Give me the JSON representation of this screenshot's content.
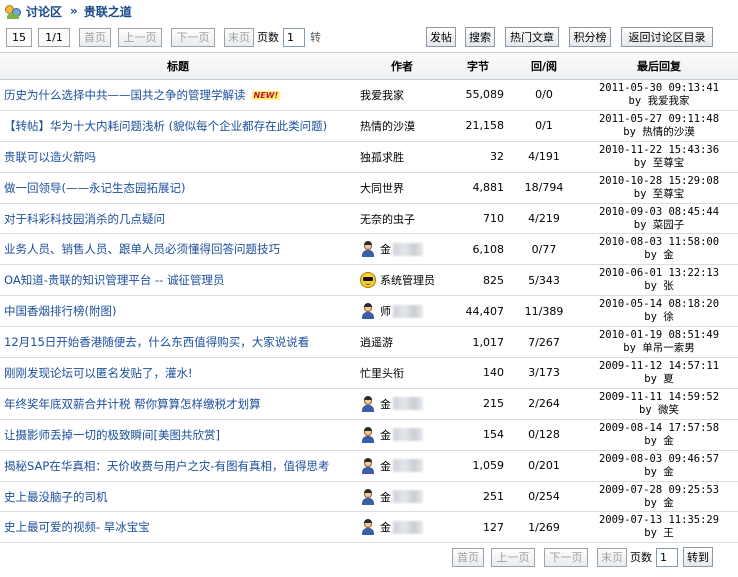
{
  "breadcrumb": {
    "root": "讨论区",
    "separator": "»",
    "current": "贵联之道"
  },
  "pager": {
    "per_page": "15",
    "page_of": "1/1",
    "first": "首页",
    "prev": "上一页",
    "next": "下一页",
    "last": "末页",
    "page_label": "页数",
    "page_value": "1",
    "jump_partial": "转",
    "jump": "转到"
  },
  "actions": {
    "post": "发帖",
    "search": "搜索",
    "hot": "热门文章",
    "ranking": "积分榜",
    "back": "返回讨论区目录"
  },
  "columns": {
    "title": "标题",
    "author": "作者",
    "bytes": "字节",
    "reply_view": "回/阅",
    "last_reply": "最后回复"
  },
  "new_badge": "NEW!",
  "rows": [
    {
      "title": "历史为什么选择中共——国共之争的管理学解读",
      "new": true,
      "author": "我爱我家",
      "avatar": "none",
      "bytes": "55,089",
      "rv": "0/0",
      "time": "2011-05-30 09:13:41",
      "by": "by 我爱我家"
    },
    {
      "title": "【转帖】华为十大内耗问题浅析 (貌似每个企业都存在此类问题)",
      "new": false,
      "author": "热情的沙漠",
      "avatar": "none",
      "bytes": "21,158",
      "rv": "0/1",
      "time": "2011-05-27 09:11:48",
      "by": "by 热情的沙漠"
    },
    {
      "title": "贵联可以造火箭吗",
      "new": false,
      "author": "独孤求胜",
      "avatar": "none",
      "bytes": "32",
      "rv": "4/191",
      "time": "2010-11-22 15:43:36",
      "by": "by 至尊宝"
    },
    {
      "title": "做一回领导(——永记生态园拓展记)",
      "new": false,
      "author": "大同世界",
      "avatar": "none",
      "bytes": "4,881",
      "rv": "18/794",
      "time": "2010-10-28 15:29:08",
      "by": "by 至尊宝"
    },
    {
      "title": "对于科彩科技园消杀的几点疑问",
      "new": false,
      "author": "无奈的虫子",
      "avatar": "none",
      "bytes": "710",
      "rv": "4/219",
      "time": "2010-09-03 08:45:44",
      "by": "by 菜园子"
    },
    {
      "title": "业务人员、销售人员、跟单人员必须懂得回答问题技巧",
      "new": false,
      "author": "金",
      "avatar": "person",
      "bytes": "6,108",
      "rv": "0/77",
      "time": "2010-08-03 11:58:00",
      "by": "by 金"
    },
    {
      "title": "OA知道-贵联的知识管理平台 -- 诚征管理员",
      "new": false,
      "author": "系统管理员",
      "avatar": "smiley",
      "bytes": "825",
      "rv": "5/343",
      "time": "2010-06-01 13:22:13",
      "by": "by 张"
    },
    {
      "title": "中国香烟排行榜(附图)",
      "new": false,
      "author": "师",
      "avatar": "person",
      "bytes": "44,407",
      "rv": "11/389",
      "time": "2010-05-14 08:18:20",
      "by": "by 徐"
    },
    {
      "title": "12月15日开始香港随便去，什么东西值得购买，大家说说看",
      "new": false,
      "author": "逍遥游",
      "avatar": "none",
      "bytes": "1,017",
      "rv": "7/267",
      "time": "2010-01-19 08:51:49",
      "by": "by 单吊一索男"
    },
    {
      "title": "刚刚发现论坛可以匿名发贴了，灌水!",
      "new": false,
      "author": "忙里头衔",
      "avatar": "none",
      "bytes": "140",
      "rv": "3/173",
      "time": "2009-11-12 14:57:11",
      "by": "by 夏"
    },
    {
      "title": "年终奖年底双薪合并计税 帮你算算怎样缴税才划算",
      "new": false,
      "author": "金",
      "avatar": "person",
      "bytes": "215",
      "rv": "2/264",
      "time": "2009-11-11 14:59:52",
      "by": "by 微笑"
    },
    {
      "title": "让摄影师丢掉一切的极致瞬间[美图共欣赏]",
      "new": false,
      "author": "金",
      "avatar": "person",
      "bytes": "154",
      "rv": "0/128",
      "time": "2009-08-14 17:57:58",
      "by": "by 金"
    },
    {
      "title": "揭秘SAP在华真相：天价收费与用户之灾-有图有真相，值得思考",
      "new": false,
      "author": "金",
      "avatar": "person",
      "bytes": "1,059",
      "rv": "0/201",
      "time": "2009-08-03 09:46:57",
      "by": "by 金"
    },
    {
      "title": "史上最没脑子的司机",
      "new": false,
      "author": "金",
      "avatar": "person",
      "bytes": "251",
      "rv": "0/254",
      "time": "2009-07-28 09:25:53",
      "by": "by 金"
    },
    {
      "title": "史上最可爱的视频- 旱冰宝宝",
      "new": false,
      "author": "金",
      "avatar": "person",
      "bytes": "127",
      "rv": "1/269",
      "time": "2009-07-13 11:35:29",
      "by": "by 王"
    }
  ],
  "colors": {
    "link": "#1b4f9c",
    "crumb": "#1a4a8a",
    "border": "#c8cdd2"
  }
}
